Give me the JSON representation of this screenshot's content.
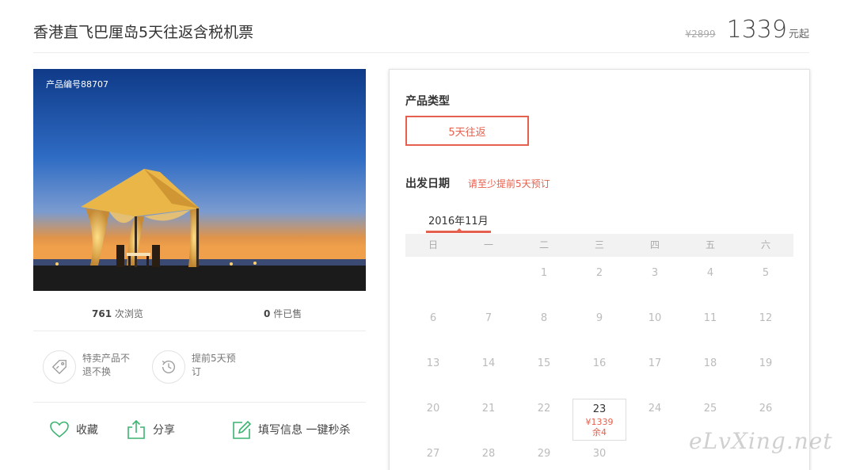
{
  "product": {
    "title": "香港直飞巴厘岛5天往返含税机票",
    "old_price": "¥2899",
    "price": "1339",
    "price_suffix": "元起",
    "code_label": "产品编号88707"
  },
  "stats": {
    "views_count": "761",
    "views_label": "次浏览",
    "sold_count": "0",
    "sold_label": "件已售"
  },
  "features": [
    {
      "icon": "tag-icon",
      "text": "特卖产品不退不换"
    },
    {
      "icon": "clock-history-icon",
      "text": "提前5天预订"
    }
  ],
  "actions": {
    "favorite": "收藏",
    "share": "分享",
    "fill_info": "填写信息 一键秒杀"
  },
  "booking": {
    "type_label": "产品类型",
    "type_option": "5天往返",
    "date_label": "出发日期",
    "date_note": "请至少提前5天预订",
    "month": "2016年11月",
    "weekdays": [
      "日",
      "一",
      "二",
      "三",
      "四",
      "五",
      "六"
    ],
    "weeks": [
      [
        "",
        "",
        "1",
        "2",
        "3",
        "4",
        "5"
      ],
      [
        "6",
        "7",
        "8",
        "9",
        "10",
        "11",
        "12"
      ],
      [
        "13",
        "14",
        "15",
        "16",
        "17",
        "18",
        "19"
      ],
      [
        "20",
        "21",
        "22",
        "23",
        "24",
        "25",
        "26"
      ],
      [
        "27",
        "28",
        "29",
        "30",
        "",
        "",
        ""
      ]
    ],
    "available": {
      "day": "23",
      "price": "¥1339",
      "stock": "余4"
    }
  },
  "watermark": "eLvXing.net",
  "colors": {
    "accent": "#e5604e",
    "icon_green": "#3cb371"
  }
}
